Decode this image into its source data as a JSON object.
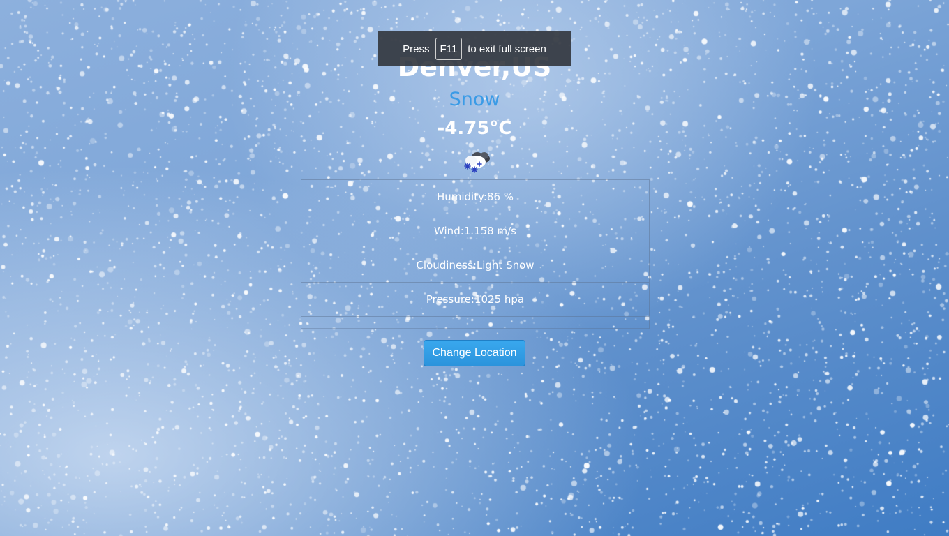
{
  "weather": {
    "city": "Denver,US",
    "condition": "Snow",
    "temperature": "-4.75°C",
    "icon": "snow-cloud-icon"
  },
  "details": {
    "humidity": "Humidity:86 %",
    "wind": "Wind:1.158 m/s",
    "cloudiness": "Cloudiness:Light Snow",
    "pressure": "Pressure:1025 hpa"
  },
  "actions": {
    "change_location_label": "Change Location"
  },
  "fullscreen_notice": {
    "prefix": "Press",
    "key": "F11",
    "suffix": "to exit full screen"
  },
  "colors": {
    "condition_text": "#3a9be6",
    "button": "#2b93dc",
    "background": "#5f90cc"
  }
}
